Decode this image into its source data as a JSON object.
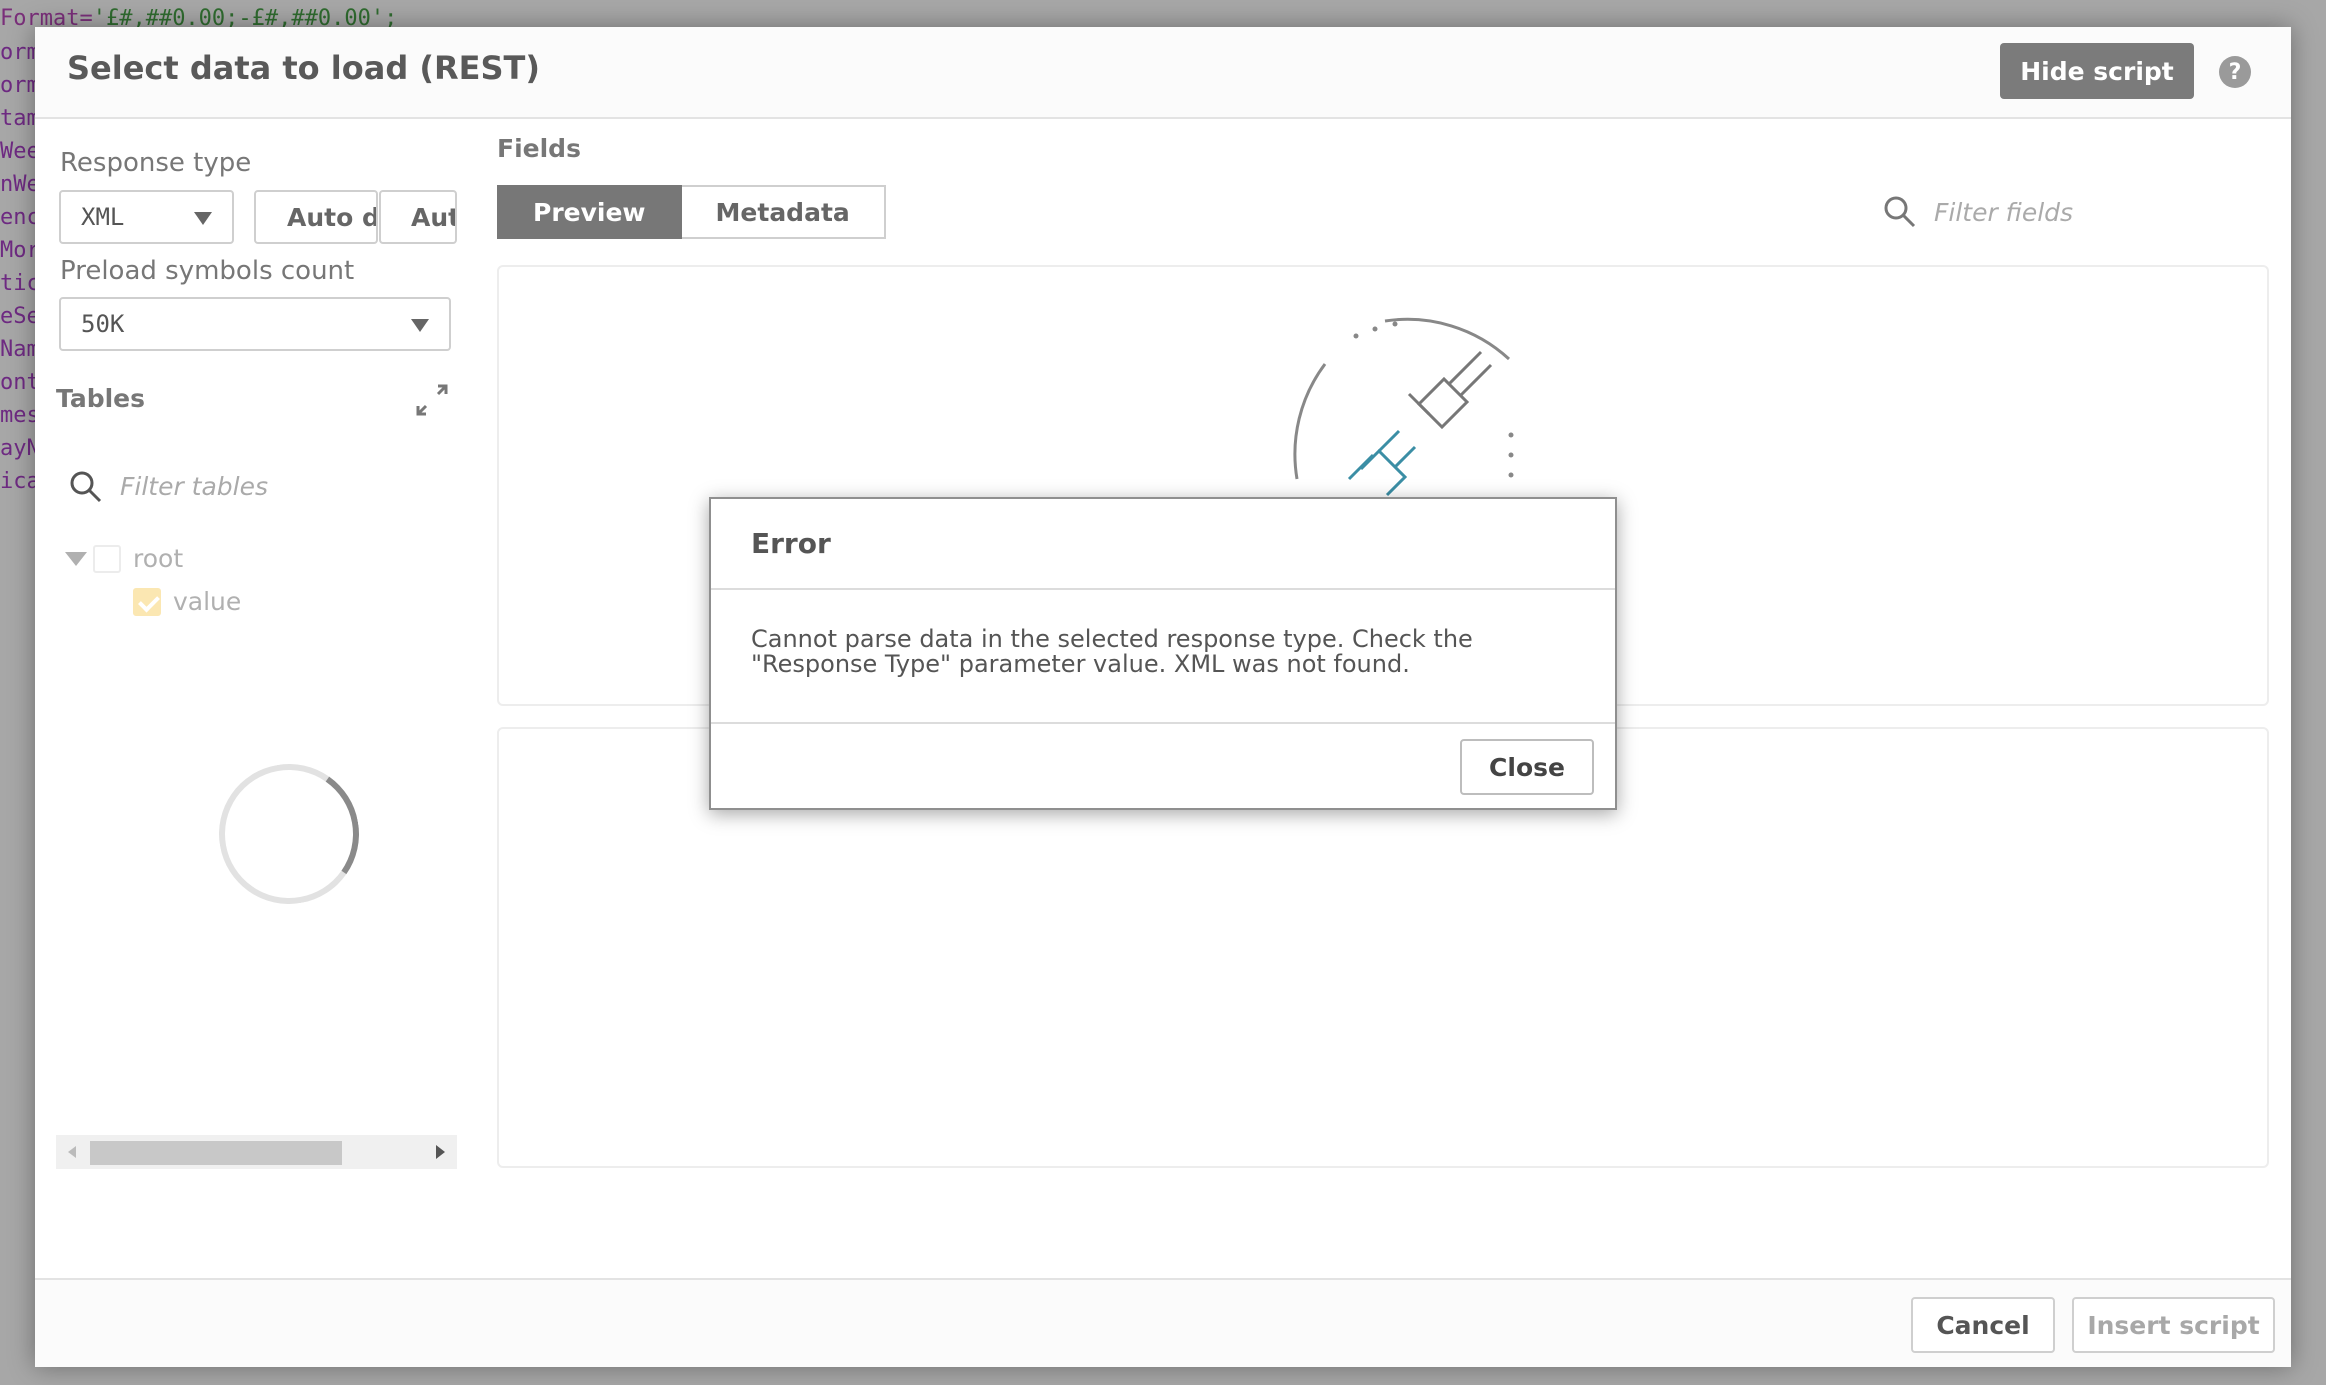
{
  "background_script": {
    "line_prefix": "Format=",
    "line_string": "'£#,##0.00;-£#,##0.00';",
    "fragments": [
      "orm",
      "orm",
      "tam",
      "Wee",
      "nWe",
      "enc",
      "Mor",
      "tic",
      "eSe",
      "Nam",
      "ont",
      "mes",
      "ayN",
      "ica"
    ]
  },
  "dialog": {
    "title": "Select data to load (REST)",
    "hide_script_label": "Hide script",
    "help_glyph": "?"
  },
  "left_panel": {
    "response_type_label": "Response type",
    "response_type_value": "XML",
    "auto_detect_label": "Auto detect",
    "auto_label_2": "Auto",
    "preload_label": "Preload symbols count",
    "preload_value": "50K",
    "tables_title": "Tables",
    "filter_tables_placeholder": "Filter tables",
    "tree": {
      "root_label": "root",
      "child_label": "value"
    }
  },
  "fields": {
    "title": "Fields",
    "tabs": [
      {
        "label": "Preview",
        "active": true
      },
      {
        "label": "Metadata",
        "active": false
      }
    ],
    "filter_placeholder": "Filter fields"
  },
  "footer": {
    "cancel_label": "Cancel",
    "insert_label": "Insert script"
  },
  "error_modal": {
    "title": "Error",
    "message": "Cannot parse data in the selected response type. Check the \"Response Type\" parameter value. XML was not found.",
    "close_label": "Close"
  },
  "colors": {
    "accent_gray": "#777777",
    "plug_teal": "#3b8ea5",
    "checkbox_checked": "#fbe7b2"
  },
  "icons": [
    "help-icon",
    "expand-icon",
    "search-icon",
    "plug-disconnected-icon",
    "loading-spinner-icon",
    "chevron-down-icon"
  ]
}
